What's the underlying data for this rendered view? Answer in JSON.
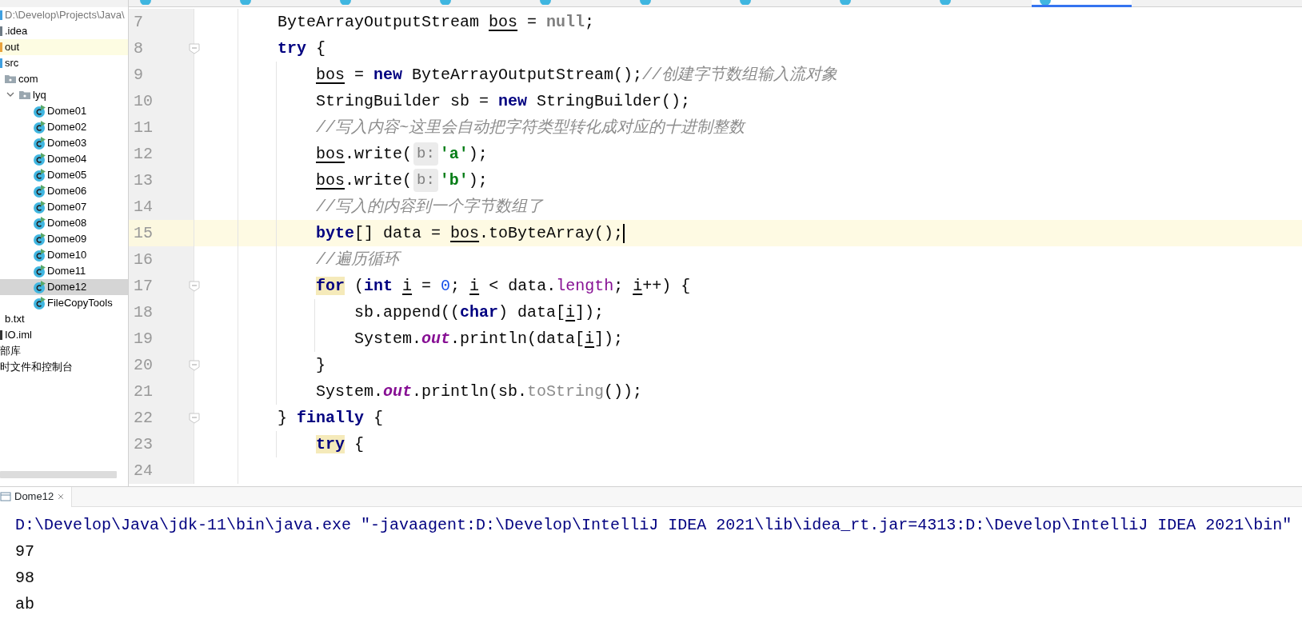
{
  "editor_tabs": [
    {
      "selected": false
    },
    {
      "selected": false
    },
    {
      "selected": false
    },
    {
      "selected": false
    },
    {
      "selected": false
    },
    {
      "selected": false
    },
    {
      "selected": false
    },
    {
      "selected": false
    },
    {
      "selected": false
    },
    {
      "selected": true
    }
  ],
  "project_tree": [
    {
      "label": "D:\\Develop\\Projects\\Java\\",
      "kind": "root",
      "selected": false,
      "excluded": false,
      "children": [
        {
          "label": ".idea",
          "kind": "folder",
          "selected": false,
          "excluded": false
        },
        {
          "label": "out",
          "kind": "folder",
          "selected": false,
          "excluded": true
        },
        {
          "label": "src",
          "kind": "source",
          "selected": false,
          "excluded": false,
          "children": [
            {
              "label": "com",
              "kind": "package",
              "selected": false,
              "excluded": false
            },
            {
              "label": "lyq",
              "kind": "package",
              "selected": false,
              "excluded": false,
              "expanded": true,
              "children": [
                {
                  "label": "Dome01",
                  "kind": "class",
                  "selected": false,
                  "excluded": false
                },
                {
                  "label": "Dome02",
                  "kind": "class",
                  "selected": false,
                  "excluded": false
                },
                {
                  "label": "Dome03",
                  "kind": "class",
                  "selected": false,
                  "excluded": false
                },
                {
                  "label": "Dome04",
                  "kind": "class",
                  "selected": false,
                  "excluded": false
                },
                {
                  "label": "Dome05",
                  "kind": "class",
                  "selected": false,
                  "excluded": false
                },
                {
                  "label": "Dome06",
                  "kind": "class",
                  "selected": false,
                  "excluded": false
                },
                {
                  "label": "Dome07",
                  "kind": "class",
                  "selected": false,
                  "excluded": false
                },
                {
                  "label": "Dome08",
                  "kind": "class",
                  "selected": false,
                  "excluded": false
                },
                {
                  "label": "Dome09",
                  "kind": "class",
                  "selected": false,
                  "excluded": false
                },
                {
                  "label": "Dome10",
                  "kind": "class",
                  "selected": false,
                  "excluded": false
                },
                {
                  "label": "Dome11",
                  "kind": "class",
                  "selected": false,
                  "excluded": false
                },
                {
                  "label": "Dome12",
                  "kind": "class",
                  "selected": true,
                  "excluded": false
                },
                {
                  "label": "FileCopyTools",
                  "kind": "class",
                  "selected": false,
                  "excluded": false
                }
              ]
            }
          ]
        },
        {
          "label": "b.txt",
          "kind": "file",
          "selected": false,
          "excluded": false
        },
        {
          "label": "IO.iml",
          "kind": "module",
          "selected": false,
          "excluded": false
        }
      ]
    },
    {
      "label": "部库",
      "kind": "library",
      "selected": false,
      "excluded": false
    },
    {
      "label": "时文件和控制台",
      "kind": "library",
      "selected": false,
      "excluded": false
    }
  ],
  "code_lines": [
    {
      "number": "7",
      "fold": false,
      "current": false,
      "tokens": [
        {
          "t": "ByteArrayOutputStream ",
          "kind": "plain"
        },
        {
          "t": "bos",
          "kind": "var"
        },
        {
          "t": " = ",
          "kind": "plain"
        },
        {
          "t": "null",
          "kind": "null"
        },
        {
          "t": ";",
          "kind": "plain"
        }
      ]
    },
    {
      "number": "8",
      "fold": true,
      "current": false,
      "tokens": [
        {
          "t": "try",
          "kind": "kw"
        },
        {
          "t": " {",
          "kind": "plain"
        }
      ],
      "children": [
        {
          "number": "9",
          "fold": false,
          "current": false,
          "tokens": [
            {
              "t": "bos",
              "kind": "var"
            },
            {
              "t": " = ",
              "kind": "plain"
            },
            {
              "t": "new",
              "kind": "kw"
            },
            {
              "t": " ByteArrayOutputStream();",
              "kind": "plain"
            },
            {
              "t": "//创建字节数组输入流对象",
              "kind": "comment"
            }
          ]
        },
        {
          "number": "10",
          "fold": false,
          "current": false,
          "tokens": [
            {
              "t": "StringBuilder sb = ",
              "kind": "plain"
            },
            {
              "t": "new",
              "kind": "kw"
            },
            {
              "t": " StringBuilder();",
              "kind": "plain"
            }
          ]
        },
        {
          "number": "11",
          "fold": false,
          "current": false,
          "tokens": [
            {
              "t": "//写入内容~这里会自动把字符类型转化成对应的十进制整数",
              "kind": "comment"
            }
          ]
        },
        {
          "number": "12",
          "fold": false,
          "current": false,
          "tokens": [
            {
              "t": "bos",
              "kind": "var"
            },
            {
              "t": ".write(",
              "kind": "plain"
            },
            {
              "t": "b:",
              "kind": "hint"
            },
            {
              "t": "'a'",
              "kind": "str"
            },
            {
              "t": ");",
              "kind": "plain"
            }
          ]
        },
        {
          "number": "13",
          "fold": false,
          "current": false,
          "tokens": [
            {
              "t": "bos",
              "kind": "var"
            },
            {
              "t": ".write(",
              "kind": "plain"
            },
            {
              "t": "b:",
              "kind": "hint"
            },
            {
              "t": "'b'",
              "kind": "str"
            },
            {
              "t": ");",
              "kind": "plain"
            }
          ]
        },
        {
          "number": "14",
          "fold": false,
          "current": false,
          "tokens": [
            {
              "t": "//写入的内容到一个字节数组了",
              "kind": "comment"
            }
          ]
        },
        {
          "number": "15",
          "fold": false,
          "current": true,
          "tokens": [
            {
              "t": "byte",
              "kind": "kw"
            },
            {
              "t": "[] data = ",
              "kind": "plain"
            },
            {
              "t": "bos",
              "kind": "var"
            },
            {
              "t": ".toByteArray();",
              "kind": "plain"
            }
          ]
        },
        {
          "number": "16",
          "fold": false,
          "current": false,
          "tokens": [
            {
              "t": "//遍历循环",
              "kind": "comment"
            }
          ]
        },
        {
          "number": "17",
          "fold": true,
          "current": false,
          "tokens": [
            {
              "t": "for",
              "kind": "kw-match"
            },
            {
              "t": " (",
              "kind": "plain"
            },
            {
              "t": "int ",
              "kind": "kw"
            },
            {
              "t": "i",
              "kind": "var"
            },
            {
              "t": " = ",
              "kind": "plain"
            },
            {
              "t": "0",
              "kind": "num"
            },
            {
              "t": "; ",
              "kind": "plain"
            },
            {
              "t": "i",
              "kind": "var"
            },
            {
              "t": " < data.",
              "kind": "plain"
            },
            {
              "t": "length",
              "kind": "field"
            },
            {
              "t": "; ",
              "kind": "plain"
            },
            {
              "t": "i",
              "kind": "var"
            },
            {
              "t": "++) {",
              "kind": "plain"
            }
          ],
          "children": [
            {
              "number": "18",
              "fold": false,
              "current": false,
              "tokens": [
                {
                  "t": "sb.append((",
                  "kind": "plain"
                },
                {
                  "t": "char",
                  "kind": "kw"
                },
                {
                  "t": ") data[",
                  "kind": "plain"
                },
                {
                  "t": "i",
                  "kind": "var"
                },
                {
                  "t": "]);",
                  "kind": "plain"
                }
              ]
            },
            {
              "number": "19",
              "fold": false,
              "current": false,
              "tokens": [
                {
                  "t": "System.",
                  "kind": "plain"
                },
                {
                  "t": "out",
                  "kind": "static"
                },
                {
                  "t": ".println(data[",
                  "kind": "plain"
                },
                {
                  "t": "i",
                  "kind": "var"
                },
                {
                  "t": "]);",
                  "kind": "plain"
                }
              ]
            }
          ]
        },
        {
          "number": "20",
          "fold": true,
          "current": false,
          "tokens": [
            {
              "t": "}",
              "kind": "plain"
            }
          ]
        },
        {
          "number": "21",
          "fold": false,
          "current": false,
          "tokens": [
            {
              "t": "System.",
              "kind": "plain"
            },
            {
              "t": "out",
              "kind": "static"
            },
            {
              "t": ".println(sb.",
              "kind": "plain"
            },
            {
              "t": "toString",
              "kind": "dim"
            },
            {
              "t": "());",
              "kind": "plain"
            }
          ]
        }
      ]
    },
    {
      "number": "22",
      "fold": true,
      "current": false,
      "tokens": [
        {
          "t": "} ",
          "kind": "plain"
        },
        {
          "t": "finally",
          "kind": "kw"
        },
        {
          "t": " {",
          "kind": "plain"
        }
      ],
      "children": [
        {
          "number": "23",
          "fold": false,
          "current": false,
          "tokens": [
            {
              "t": "try",
              "kind": "kw-match"
            },
            {
              "t": " {",
              "kind": "plain"
            }
          ]
        }
      ]
    },
    {
      "number": "24",
      "fold": false,
      "current": false
    }
  ],
  "run_panel": {
    "tab": "Dome12",
    "lines": [
      {
        "text": "D:\\Develop\\Java\\jdk-11\\bin\\java.exe \"-javaagent:D:\\Develop\\IntelliJ IDEA 2021\\lib\\idea_rt.jar=4313:D:\\Develop\\IntelliJ IDEA 2021\\bin\"",
        "kind": "command"
      },
      {
        "text": "97",
        "kind": "output"
      },
      {
        "text": "98",
        "kind": "output"
      },
      {
        "text": "ab",
        "kind": "output"
      }
    ]
  }
}
